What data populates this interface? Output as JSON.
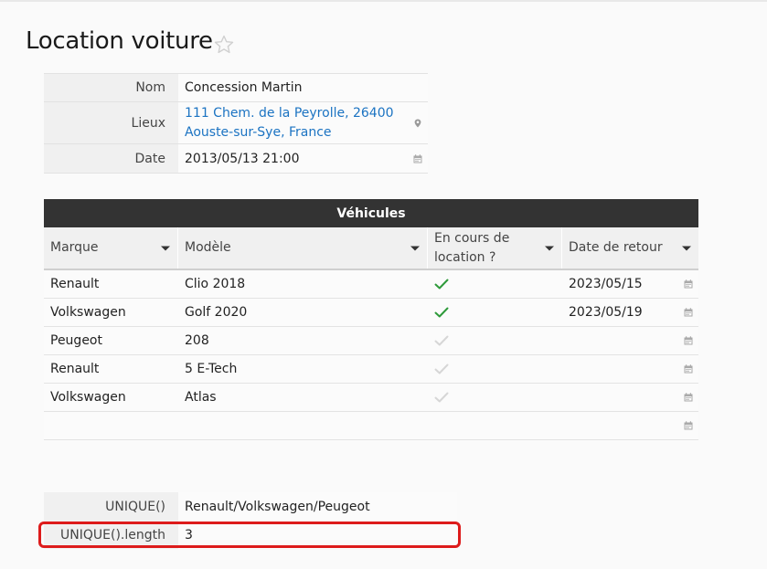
{
  "page": {
    "title": "Location voiture"
  },
  "form": {
    "rows": [
      {
        "label": "Nom",
        "value": "Concession Martin"
      },
      {
        "label": "Lieux",
        "value_line1": "111 Chem. de la Peyrolle, 26400",
        "value_line2": "Aouste-sur-Sye, France",
        "icon": "map-pin-icon"
      },
      {
        "label": "Date",
        "value": "2013/05/13 21:00",
        "icon": "calendar-icon"
      }
    ]
  },
  "vehicles": {
    "caption": "Véhicules",
    "columns": [
      {
        "label": "Marque"
      },
      {
        "label": "Modèle"
      },
      {
        "label": "En cours de location ?"
      },
      {
        "label": "Date de retour"
      }
    ],
    "rows": [
      {
        "marque": "Renault",
        "modele": "Clio 2018",
        "en_location": true,
        "retour": "2023/05/15"
      },
      {
        "marque": "Volkswagen",
        "modele": "Golf 2020",
        "en_location": true,
        "retour": "2023/05/19"
      },
      {
        "marque": "Peugeot",
        "modele": "208",
        "en_location": false,
        "retour": ""
      },
      {
        "marque": "Renault",
        "modele": "5 E-Tech",
        "en_location": false,
        "retour": ""
      },
      {
        "marque": "Volkswagen",
        "modele": "Atlas",
        "en_location": false,
        "retour": ""
      },
      {
        "marque": "",
        "modele": "",
        "en_location": null,
        "retour": ""
      }
    ]
  },
  "formulas": {
    "rows": [
      {
        "label": "UNIQUE()",
        "value": "Renault/Volkswagen/Peugeot"
      },
      {
        "label": "UNIQUE().length",
        "value": "3"
      }
    ]
  },
  "colors": {
    "accent_link": "#1b73c2",
    "check_on": "#2e9a3a",
    "check_off": "#d6d6d6",
    "highlight": "#dd1b1b",
    "header_dark": "#333333"
  }
}
